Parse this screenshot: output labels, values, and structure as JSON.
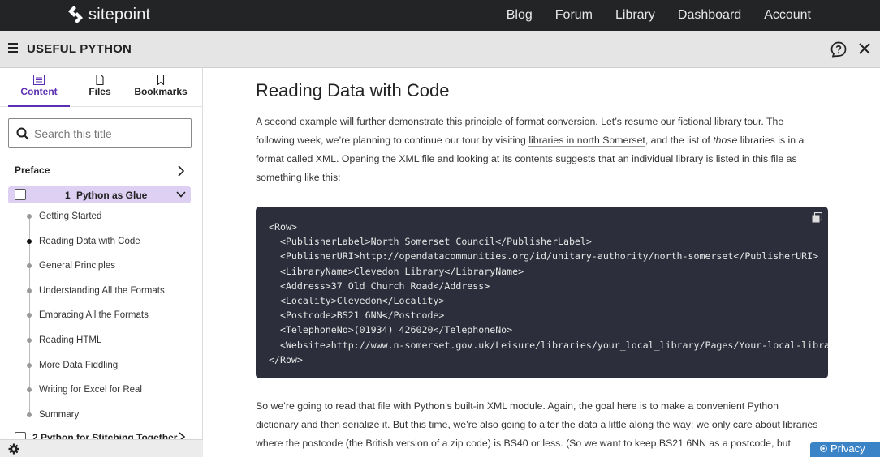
{
  "brand": {
    "name": "sitepoint"
  },
  "top_nav": [
    "Blog",
    "Forum",
    "Library",
    "Dashboard",
    "Account"
  ],
  "book": {
    "title": "USEFUL PYTHON"
  },
  "sidebar": {
    "tabs": [
      {
        "label": "Content",
        "icon": "list-icon",
        "active": true
      },
      {
        "label": "Files",
        "icon": "file-icon",
        "active": false
      },
      {
        "label": "Bookmarks",
        "icon": "bookmark-icon",
        "active": false
      }
    ],
    "search_placeholder": "Search this title",
    "preface_label": "Preface",
    "chapter": {
      "number": "1",
      "title": "Python as Glue"
    },
    "sections": [
      "Getting Started",
      "Reading Data with Code",
      "General Principles",
      "Understanding All the Formats",
      "Embracing All the Formats",
      "Reading HTML",
      "More Data Fiddling",
      "Writing for Excel for Real",
      "Summary"
    ],
    "current_section": "Reading Data with Code",
    "next_chapter": "2   Python for Stitching Together"
  },
  "article": {
    "heading": "Reading Data with Code",
    "p1": {
      "before_link": "A second example will further demonstrate this principle of format conversion. Let’s resume our fictional library tour. The following week, we’re planning to continue our tour by visiting ",
      "link": "libraries in north Somerset",
      "mid": ", and the list of ",
      "emph": "those",
      "after": " libraries is in a format called XML. Opening the XML file and looking at its contents suggests that an individual library is listed in this file as something like this:"
    },
    "code": "<Row>\n  <PublisherLabel>North Somerset Council</PublisherLabel>\n  <PublisherURI>http://opendatacommunities.org/id/unitary-authority/north-somerset</PublisherURI>\n  <LibraryName>Clevedon Library</LibraryName>\n  <Address>37 Old Church Road</Address>\n  <Locality>Clevedon</Locality>\n  <Postcode>BS21 6NN</Postcode>\n  <TelephoneNo>(01934) 426020</TelephoneNo>\n  <Website>http://www.n-somerset.gov.uk/Leisure/libraries/your_local_library/Pages/Your-local-library.aspx</Website>\n</Row>",
    "p2": {
      "before_link": "So we’re going to read that file with Python’s built-in ",
      "link": "XML module",
      "after": ". Again, the goal here is to make a convenient Python dictionary and then serialize it. But this time, we’re also going to alter the data a little along the way: we only care about libraries where the postcode (the British version of a zip code) is BS40 or less. (So we want to keep BS21 6NN as a postcode, but ignore"
    }
  },
  "privacy_label": "Privacy",
  "colors": {
    "accent": "#5b2fb3",
    "topbar": "#222426",
    "code_bg": "#2c2e3b",
    "privacy": "#3a83c7"
  }
}
